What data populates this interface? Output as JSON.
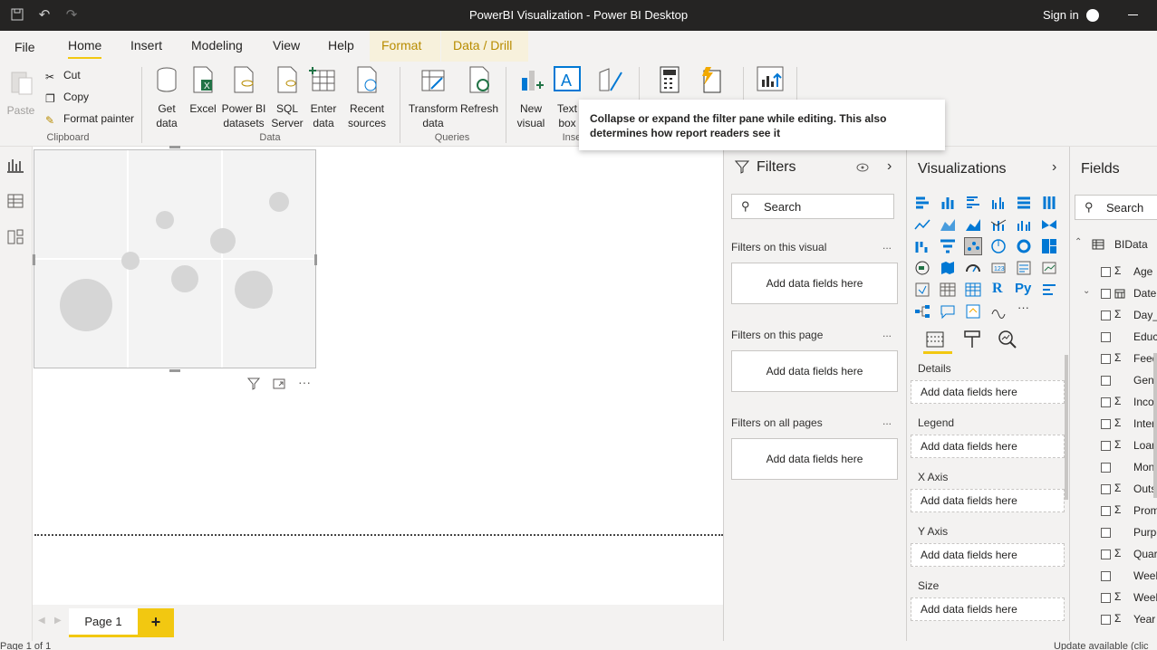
{
  "titlebar": {
    "title": "PowerBI Visualization - Power BI Desktop",
    "signin": "Sign in"
  },
  "menu": {
    "file": "File",
    "home": "Home",
    "insert": "Insert",
    "modeling": "Modeling",
    "view": "View",
    "help": "Help",
    "format": "Format",
    "data_drill": "Data / Drill"
  },
  "ribbon": {
    "paste": "Paste",
    "cut": "Cut",
    "copy": "Copy",
    "format_painter": "Format painter",
    "clipboard": "Clipboard",
    "get_data_1": "Get",
    "get_data_2": "data",
    "excel": "Excel",
    "pbi_1": "Power BI",
    "pbi_2": "datasets",
    "sql_1": "SQL",
    "sql_2": "Server",
    "enter_1": "Enter",
    "enter_2": "data",
    "recent_1": "Recent",
    "recent_2": "sources",
    "data_group": "Data",
    "transform_1": "Transform",
    "transform_2": "data",
    "refresh": "Refresh",
    "queries": "Queries",
    "new_visual_1": "New",
    "new_visual_2": "visual",
    "text_box_1": "Text",
    "text_box_2": "box",
    "insert_group": "Inse"
  },
  "tooltip": {
    "text": "Collapse or expand the filter pane while editing. This also determines how report readers see it"
  },
  "filters": {
    "title": "Filters",
    "search_placeholder": "Search",
    "on_visual": "Filters on this visual",
    "on_page": "Filters on this page",
    "on_all": "Filters on all pages",
    "add_fields": "Add data fields here",
    "more": "..."
  },
  "visualizations": {
    "title": "Visualizations",
    "wells": [
      {
        "label": "Details",
        "placeholder": "Add data fields here"
      },
      {
        "label": "Legend",
        "placeholder": "Add data fields here"
      },
      {
        "label": "X Axis",
        "placeholder": "Add data fields here"
      },
      {
        "label": "Y Axis",
        "placeholder": "Add data fields here"
      },
      {
        "label": "Size",
        "placeholder": "Add data fields here"
      }
    ],
    "r_label": "R",
    "py_label": "Py",
    "more": "···"
  },
  "fields": {
    "title": "Fields",
    "search_placeholder": "Search",
    "table": "BIData",
    "items": [
      {
        "name": "Age",
        "sigma": "Σ"
      },
      {
        "name": "Date",
        "sigma": ""
      },
      {
        "name": "Day_",
        "sigma": "Σ"
      },
      {
        "name": "Educa",
        "sigma": ""
      },
      {
        "name": "Feedb",
        "sigma": "Σ"
      },
      {
        "name": "Gend",
        "sigma": ""
      },
      {
        "name": "Incor",
        "sigma": "Σ"
      },
      {
        "name": "Intere",
        "sigma": "Σ"
      },
      {
        "name": "Loan_",
        "sigma": "Σ"
      },
      {
        "name": "Mont",
        "sigma": ""
      },
      {
        "name": "Outst",
        "sigma": "Σ"
      },
      {
        "name": "Prom",
        "sigma": "Σ"
      },
      {
        "name": "Purpc",
        "sigma": ""
      },
      {
        "name": "Quar",
        "sigma": "Σ"
      },
      {
        "name": "Week",
        "sigma": ""
      },
      {
        "name": "Week",
        "sigma": "Σ"
      },
      {
        "name": "Year",
        "sigma": "Σ"
      }
    ]
  },
  "pages": {
    "tab": "Page 1",
    "add": "+"
  },
  "status": {
    "left": "Page 1 of 1",
    "right": "Update available (clic"
  },
  "colors": {
    "accent": "#f2c811",
    "titlebar": "#252423",
    "context": "#b88c00"
  }
}
